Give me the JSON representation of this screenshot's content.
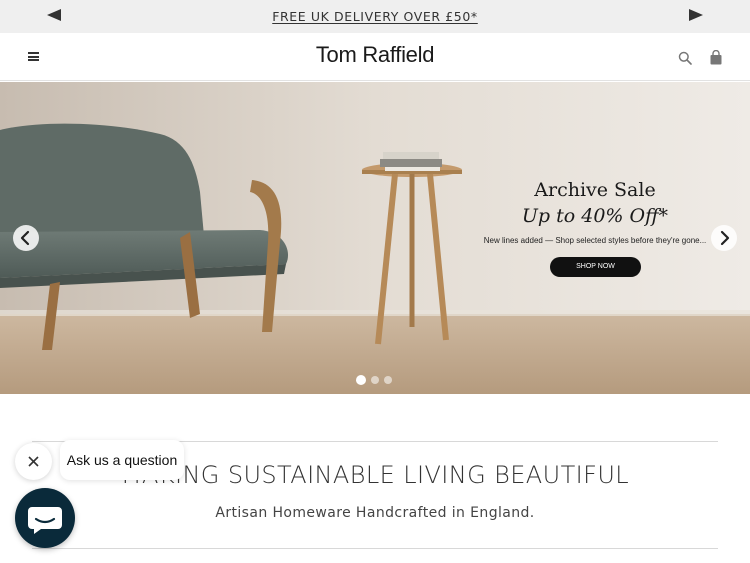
{
  "announcement": {
    "text": "FREE UK DELIVERY OVER £50*",
    "prev_icon": "triangle-left-icon",
    "next_icon": "triangle-right-icon"
  },
  "header": {
    "logo": "Tom Raffield",
    "menu_icon": "hamburger-menu-icon",
    "search_icon": "search-icon",
    "bag_icon": "shopping-bag-icon"
  },
  "hero": {
    "title": "Archive Sale",
    "subtitle": "Up to 40% Off*",
    "note": "New lines added — Shop selected styles before they're gone...",
    "cta": "SHOP NOW",
    "slide_count": 3,
    "active_slide": 1
  },
  "intro": {
    "headline": "MAKING SUSTAINABLE LIVING BEAUTIFUL",
    "tagline": "Artisan Homeware Handcrafted in England."
  },
  "chat": {
    "prompt": "Ask us a question",
    "launcher_color": "#0a2a3a"
  }
}
